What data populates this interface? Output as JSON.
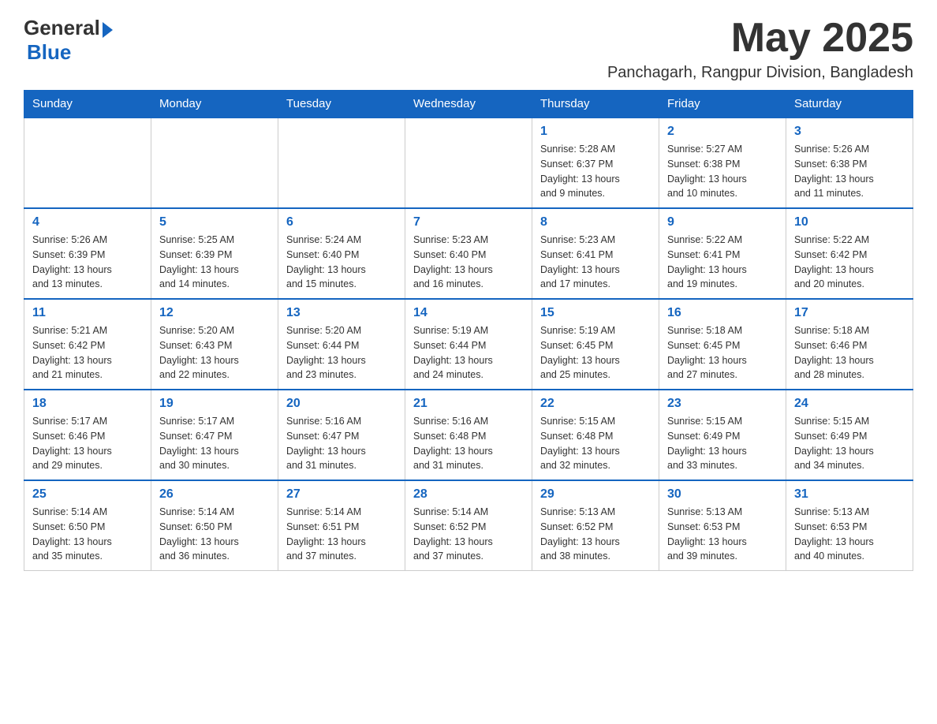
{
  "logo": {
    "text_general": "General",
    "text_blue": "Blue"
  },
  "title": {
    "month_year": "May 2025",
    "location": "Panchagarh, Rangpur Division, Bangladesh"
  },
  "days_of_week": [
    "Sunday",
    "Monday",
    "Tuesday",
    "Wednesday",
    "Thursday",
    "Friday",
    "Saturday"
  ],
  "weeks": [
    [
      {
        "day": "",
        "info": ""
      },
      {
        "day": "",
        "info": ""
      },
      {
        "day": "",
        "info": ""
      },
      {
        "day": "",
        "info": ""
      },
      {
        "day": "1",
        "info": "Sunrise: 5:28 AM\nSunset: 6:37 PM\nDaylight: 13 hours\nand 9 minutes."
      },
      {
        "day": "2",
        "info": "Sunrise: 5:27 AM\nSunset: 6:38 PM\nDaylight: 13 hours\nand 10 minutes."
      },
      {
        "day": "3",
        "info": "Sunrise: 5:26 AM\nSunset: 6:38 PM\nDaylight: 13 hours\nand 11 minutes."
      }
    ],
    [
      {
        "day": "4",
        "info": "Sunrise: 5:26 AM\nSunset: 6:39 PM\nDaylight: 13 hours\nand 13 minutes."
      },
      {
        "day": "5",
        "info": "Sunrise: 5:25 AM\nSunset: 6:39 PM\nDaylight: 13 hours\nand 14 minutes."
      },
      {
        "day": "6",
        "info": "Sunrise: 5:24 AM\nSunset: 6:40 PM\nDaylight: 13 hours\nand 15 minutes."
      },
      {
        "day": "7",
        "info": "Sunrise: 5:23 AM\nSunset: 6:40 PM\nDaylight: 13 hours\nand 16 minutes."
      },
      {
        "day": "8",
        "info": "Sunrise: 5:23 AM\nSunset: 6:41 PM\nDaylight: 13 hours\nand 17 minutes."
      },
      {
        "day": "9",
        "info": "Sunrise: 5:22 AM\nSunset: 6:41 PM\nDaylight: 13 hours\nand 19 minutes."
      },
      {
        "day": "10",
        "info": "Sunrise: 5:22 AM\nSunset: 6:42 PM\nDaylight: 13 hours\nand 20 minutes."
      }
    ],
    [
      {
        "day": "11",
        "info": "Sunrise: 5:21 AM\nSunset: 6:42 PM\nDaylight: 13 hours\nand 21 minutes."
      },
      {
        "day": "12",
        "info": "Sunrise: 5:20 AM\nSunset: 6:43 PM\nDaylight: 13 hours\nand 22 minutes."
      },
      {
        "day": "13",
        "info": "Sunrise: 5:20 AM\nSunset: 6:44 PM\nDaylight: 13 hours\nand 23 minutes."
      },
      {
        "day": "14",
        "info": "Sunrise: 5:19 AM\nSunset: 6:44 PM\nDaylight: 13 hours\nand 24 minutes."
      },
      {
        "day": "15",
        "info": "Sunrise: 5:19 AM\nSunset: 6:45 PM\nDaylight: 13 hours\nand 25 minutes."
      },
      {
        "day": "16",
        "info": "Sunrise: 5:18 AM\nSunset: 6:45 PM\nDaylight: 13 hours\nand 27 minutes."
      },
      {
        "day": "17",
        "info": "Sunrise: 5:18 AM\nSunset: 6:46 PM\nDaylight: 13 hours\nand 28 minutes."
      }
    ],
    [
      {
        "day": "18",
        "info": "Sunrise: 5:17 AM\nSunset: 6:46 PM\nDaylight: 13 hours\nand 29 minutes."
      },
      {
        "day": "19",
        "info": "Sunrise: 5:17 AM\nSunset: 6:47 PM\nDaylight: 13 hours\nand 30 minutes."
      },
      {
        "day": "20",
        "info": "Sunrise: 5:16 AM\nSunset: 6:47 PM\nDaylight: 13 hours\nand 31 minutes."
      },
      {
        "day": "21",
        "info": "Sunrise: 5:16 AM\nSunset: 6:48 PM\nDaylight: 13 hours\nand 31 minutes."
      },
      {
        "day": "22",
        "info": "Sunrise: 5:15 AM\nSunset: 6:48 PM\nDaylight: 13 hours\nand 32 minutes."
      },
      {
        "day": "23",
        "info": "Sunrise: 5:15 AM\nSunset: 6:49 PM\nDaylight: 13 hours\nand 33 minutes."
      },
      {
        "day": "24",
        "info": "Sunrise: 5:15 AM\nSunset: 6:49 PM\nDaylight: 13 hours\nand 34 minutes."
      }
    ],
    [
      {
        "day": "25",
        "info": "Sunrise: 5:14 AM\nSunset: 6:50 PM\nDaylight: 13 hours\nand 35 minutes."
      },
      {
        "day": "26",
        "info": "Sunrise: 5:14 AM\nSunset: 6:50 PM\nDaylight: 13 hours\nand 36 minutes."
      },
      {
        "day": "27",
        "info": "Sunrise: 5:14 AM\nSunset: 6:51 PM\nDaylight: 13 hours\nand 37 minutes."
      },
      {
        "day": "28",
        "info": "Sunrise: 5:14 AM\nSunset: 6:52 PM\nDaylight: 13 hours\nand 37 minutes."
      },
      {
        "day": "29",
        "info": "Sunrise: 5:13 AM\nSunset: 6:52 PM\nDaylight: 13 hours\nand 38 minutes."
      },
      {
        "day": "30",
        "info": "Sunrise: 5:13 AM\nSunset: 6:53 PM\nDaylight: 13 hours\nand 39 minutes."
      },
      {
        "day": "31",
        "info": "Sunrise: 5:13 AM\nSunset: 6:53 PM\nDaylight: 13 hours\nand 40 minutes."
      }
    ]
  ]
}
